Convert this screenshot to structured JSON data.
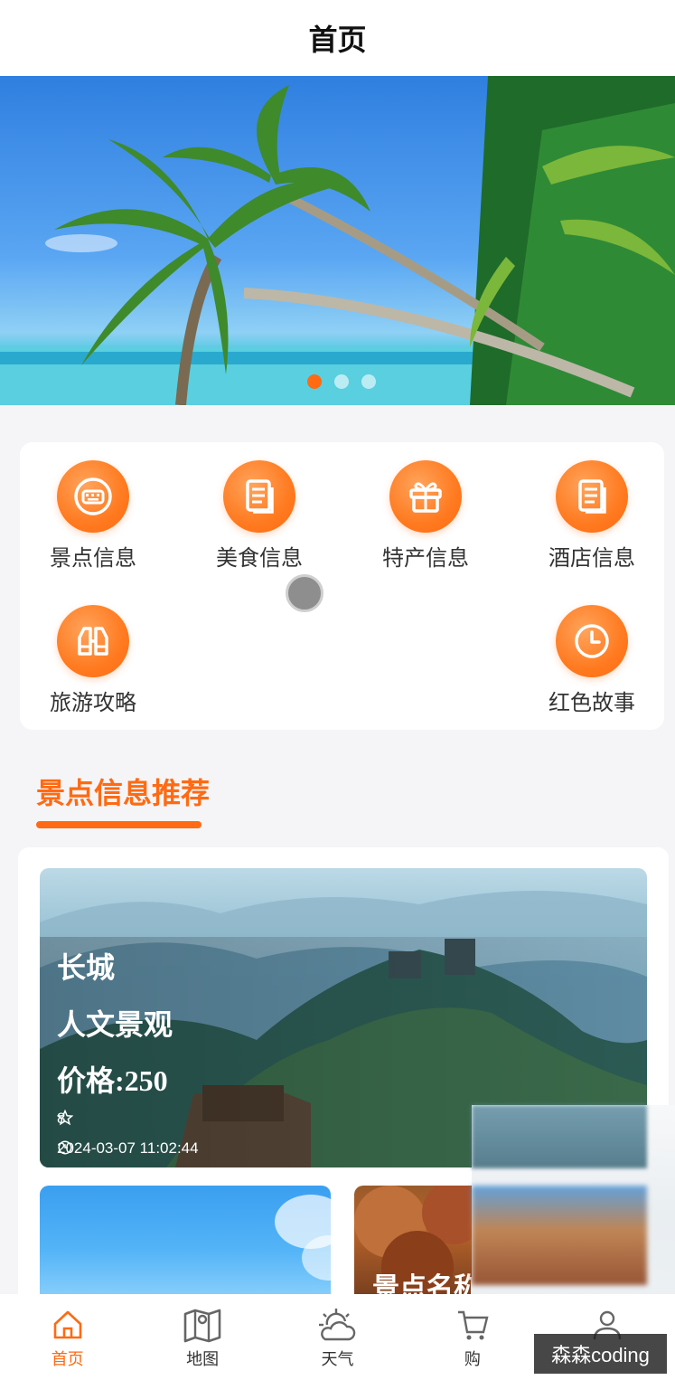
{
  "header": {
    "title": "首页"
  },
  "banner": {
    "slide_count": 3,
    "active_index": 0,
    "accent": "#ff6a13"
  },
  "categories": [
    {
      "label": "景点信息",
      "icon": "keyboard-icon"
    },
    {
      "label": "美食信息",
      "icon": "document-icon"
    },
    {
      "label": "特产信息",
      "icon": "gift-icon"
    },
    {
      "label": "酒店信息",
      "icon": "document-icon"
    },
    {
      "label": "旅游攻略",
      "icon": "binoculars-icon"
    },
    {
      "label": "红色故事",
      "icon": "clock-icon"
    }
  ],
  "section": {
    "title": "景点信息推荐"
  },
  "featured": {
    "name": "长城",
    "type": "人文景观",
    "price": "价格:250",
    "likes": "8",
    "time": "2024-03-07 11:02:44"
  },
  "cards": [
    {
      "name": ""
    },
    {
      "name": "景点名称"
    }
  ],
  "tabbar": {
    "items": [
      {
        "label": "首页",
        "icon": "home-icon",
        "active": true
      },
      {
        "label": "地图",
        "icon": "map-icon",
        "active": false
      },
      {
        "label": "天气",
        "icon": "weather-icon",
        "active": false
      },
      {
        "label": "购",
        "icon": "shopping-icon",
        "active": false
      },
      {
        "label": "",
        "icon": "user-icon",
        "active": false
      }
    ]
  },
  "watermark": "森森coding"
}
